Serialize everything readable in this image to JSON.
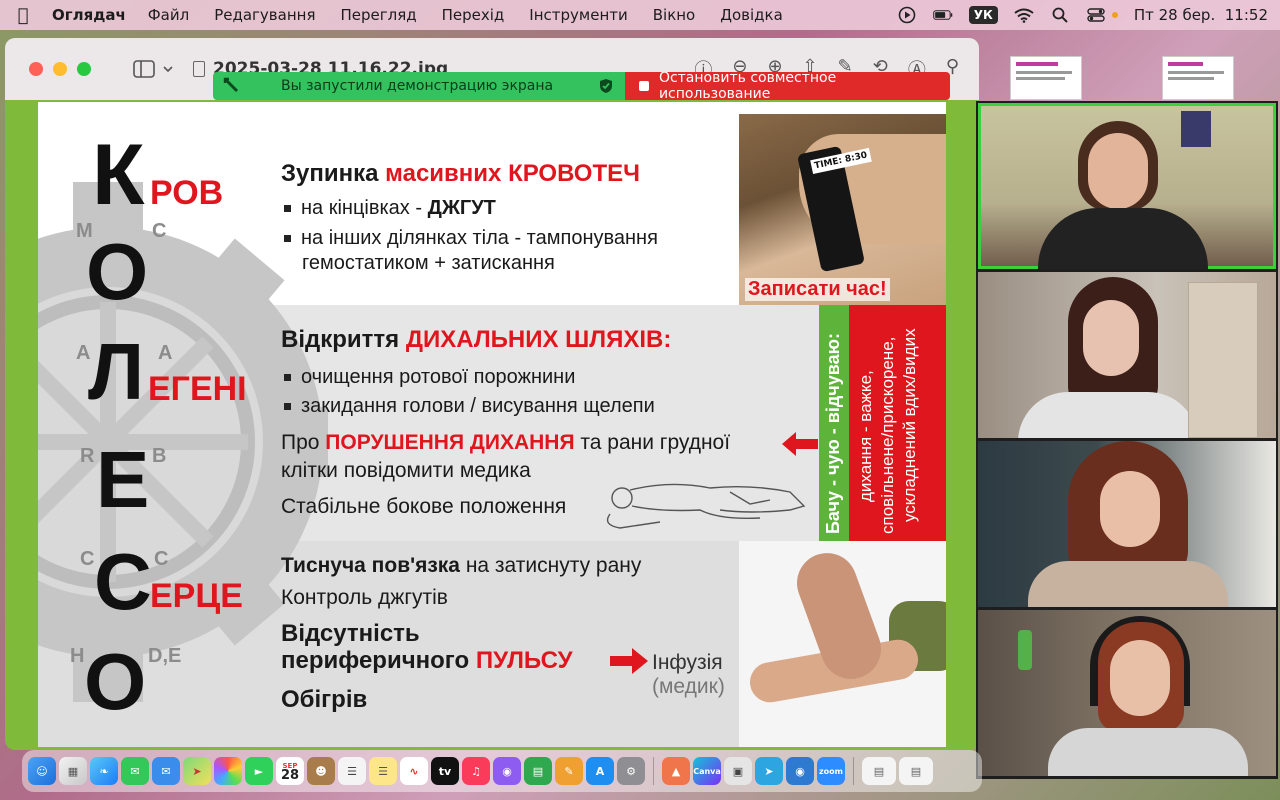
{
  "menubar": {
    "app_name": "Оглядач",
    "items": [
      "Файл",
      "Редагування",
      "Перегляд",
      "Перехід",
      "Інструменти",
      "Вікно",
      "Довідка"
    ],
    "keyboard_layout": "УК",
    "datetime": "Пт 28 бер.  11:52"
  },
  "window": {
    "title": "2025-03-28 11.16.22.jpg"
  },
  "sharebar": {
    "message": "Вы запустили демонстрацию экрана",
    "stop_label": "Остановить совместное использование"
  },
  "slide": {
    "row1": {
      "big": "К",
      "red": "РОВ",
      "heading_a": "Зупинка ",
      "heading_red": "масивних КРОВОТЕЧ",
      "b1_a": "на кінцівках - ",
      "b1_b": "ДЖГУТ",
      "b2_l1": "на інших ділянках тіла - тампонування",
      "b2_l2": "гемостатиком + затискання",
      "photo_caption": "Записати час!",
      "tag": "TIME: 8:30"
    },
    "row2": {
      "big_o": "О",
      "big": "Л",
      "red": "ЕГЕНІ",
      "heading_a": "Відкриття ",
      "heading_red": "ДИХАЛЬНИХ ШЛЯХІВ:",
      "b1": "очищення ротової порожнини",
      "b2": "закидання голови / висування щелепи",
      "line1_a": "Про ",
      "line1_red": "ПОРУШЕННЯ ДИХАННЯ",
      "line1_b": " та рани грудної",
      "line2": "клітки повідомити медика",
      "line3": "Стабільне бокове положення",
      "vert_green": "Бачу - чую - відчуваю:",
      "vert_red_1": "дихання - важке,",
      "vert_red_2": "сповільнене/прискорене,",
      "vert_red_3": "ускладнений вдих/видих"
    },
    "row3": {
      "big_e": "Е",
      "big": "С",
      "red": "ЕРЦЕ",
      "big_o": "О",
      "l1_a": "Тиснуча пов'язка",
      "l1_b": " на затиснуту рану",
      "l2": "Контроль джгутів",
      "l3": "Відсутність",
      "l4_a": "периферичного ",
      "l4_red": "ПУЛЬСУ",
      "infusion": "Інфузія",
      "medic": "(медик)",
      "l5": "Обігрів"
    },
    "letters": {
      "m": "М",
      "c1": "С",
      "a1": "А",
      "a2": "А",
      "r": "R",
      "b": "B",
      "c2": "C",
      "c3": "C",
      "h": "H",
      "de": "D,E"
    }
  },
  "dock": {
    "calendar_month": "SEP",
    "calendar_day": "28"
  },
  "colors": {
    "accent_red": "#e0161e",
    "accent_green": "#5eb43a",
    "share_green": "#33c25e"
  }
}
